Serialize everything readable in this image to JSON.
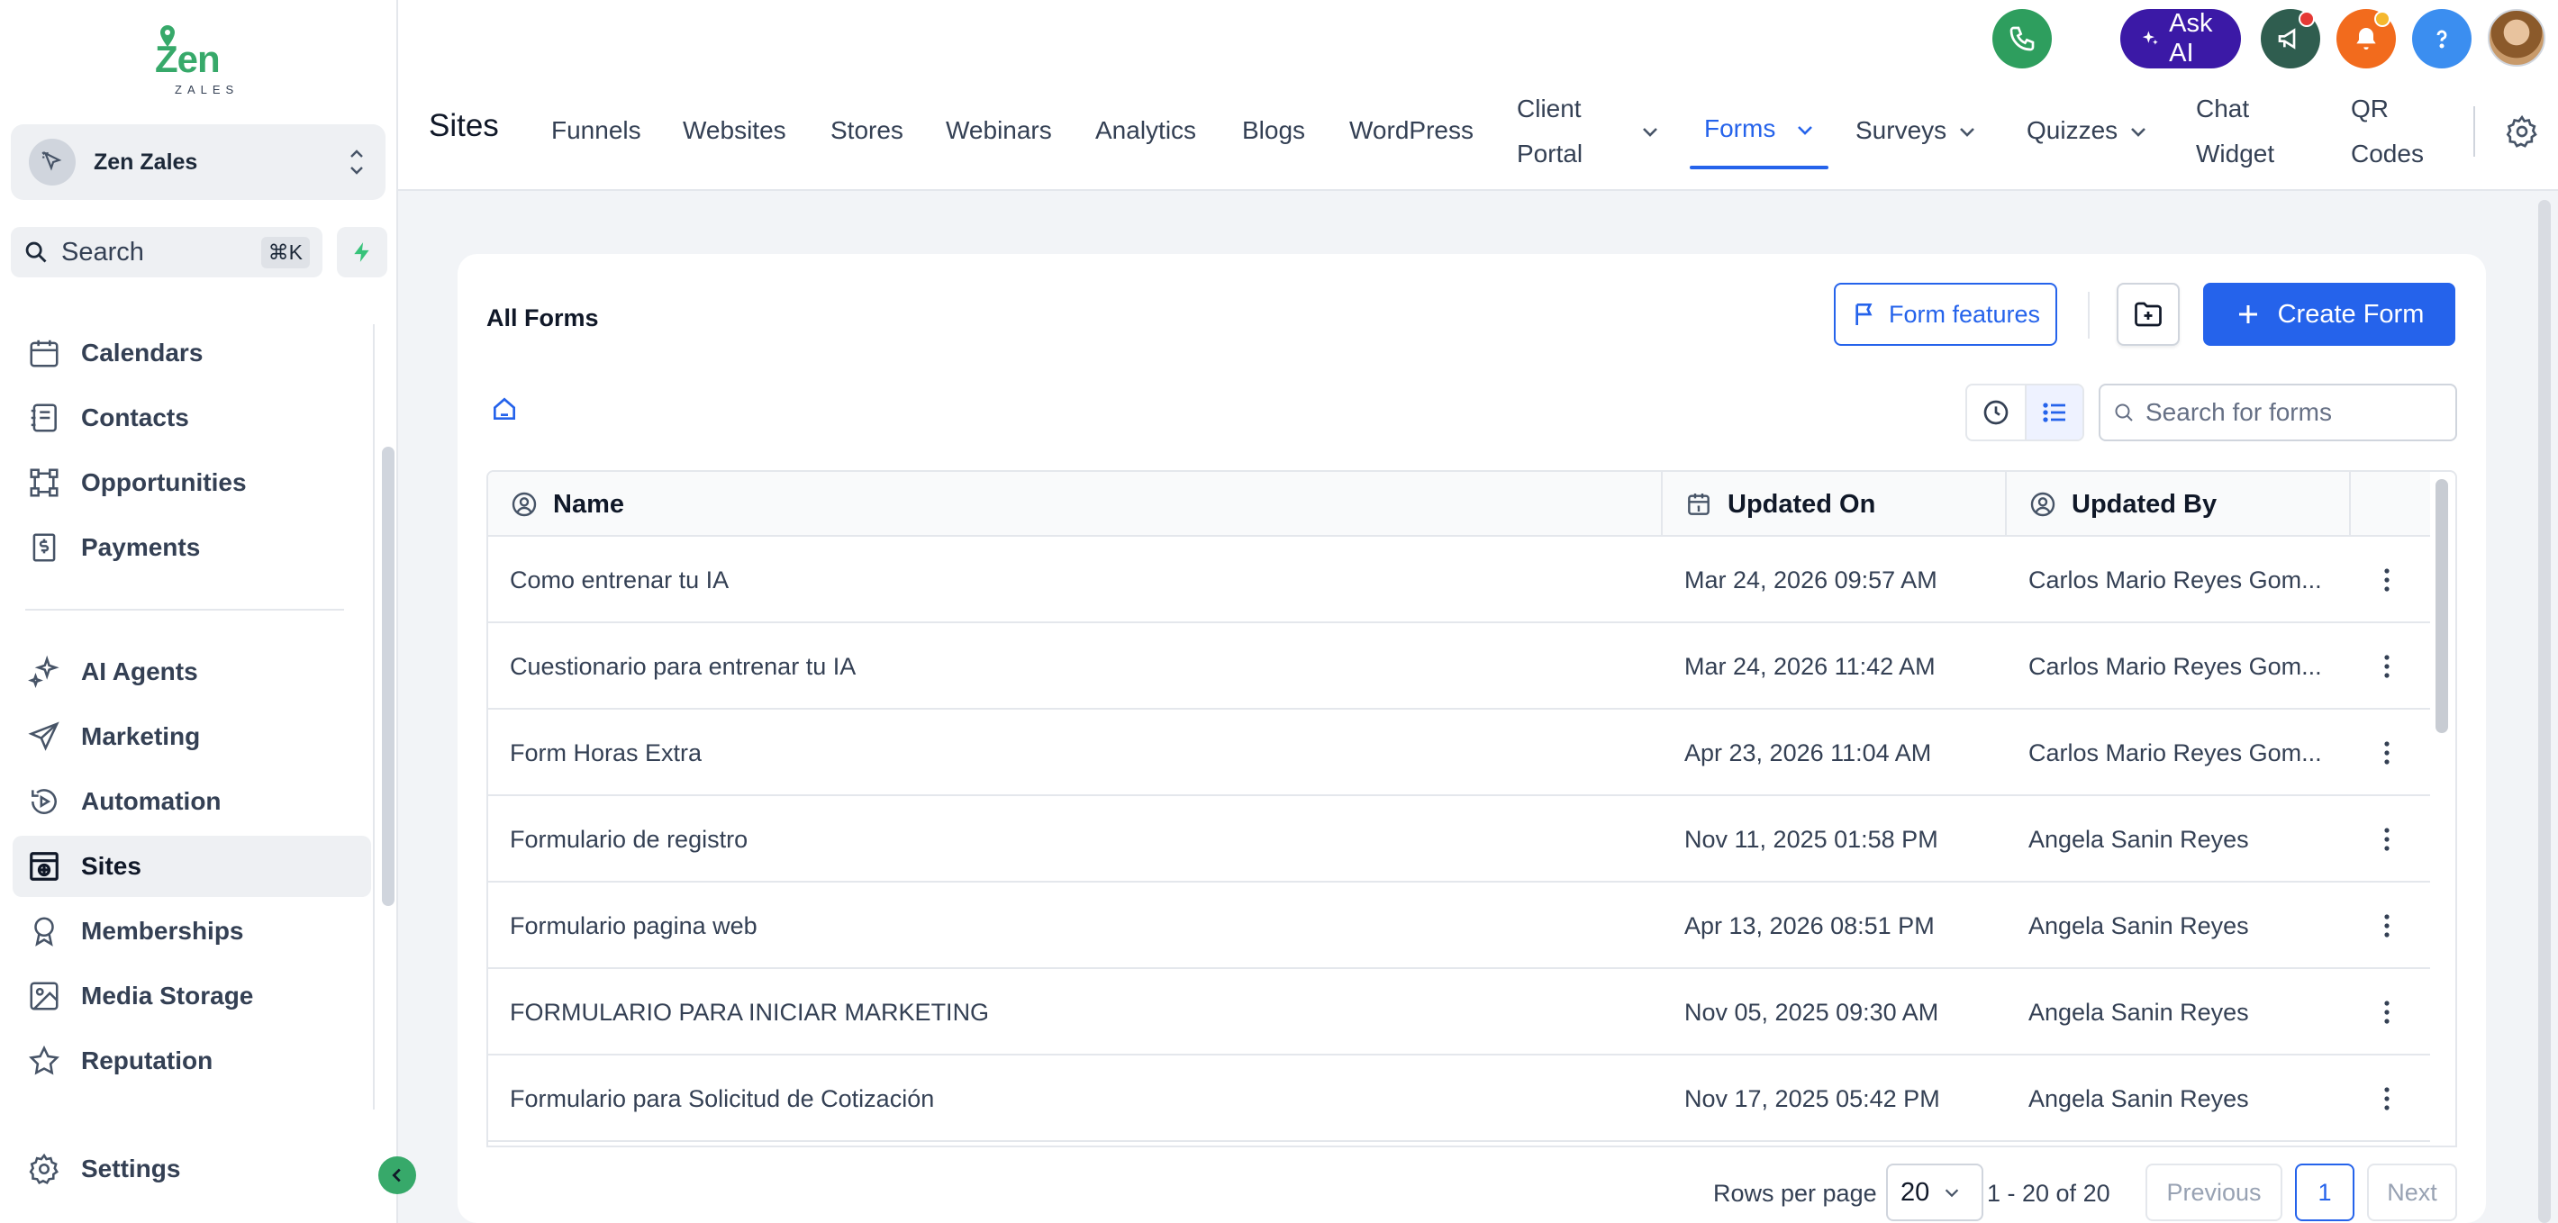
{
  "brand": {
    "logo_text": "Zen",
    "logo_sub": "ZALES",
    "accent": "#37a96a"
  },
  "account": {
    "name": "Zen Zales"
  },
  "search": {
    "label": "Search",
    "shortcut": "⌘K"
  },
  "sidebar": {
    "items": [
      {
        "label": "Calendars",
        "icon": "calendar-icon"
      },
      {
        "label": "Contacts",
        "icon": "contacts-icon"
      },
      {
        "label": "Opportunities",
        "icon": "opportunities-icon"
      },
      {
        "label": "Payments",
        "icon": "payments-icon"
      },
      {
        "label": "AI Agents",
        "icon": "sparkles-icon"
      },
      {
        "label": "Marketing",
        "icon": "send-icon"
      },
      {
        "label": "Automation",
        "icon": "automation-icon"
      },
      {
        "label": "Sites",
        "icon": "sites-icon",
        "active": true
      },
      {
        "label": "Memberships",
        "icon": "badge-icon"
      },
      {
        "label": "Media Storage",
        "icon": "image-icon"
      },
      {
        "label": "Reputation",
        "icon": "star-icon"
      }
    ],
    "settings_label": "Settings"
  },
  "header": {
    "title": "Sites",
    "ask_ai_label": "Ask AI",
    "tabs": [
      {
        "label": "Funnels"
      },
      {
        "label": "Websites"
      },
      {
        "label": "Stores"
      },
      {
        "label": "Webinars"
      },
      {
        "label": "Analytics"
      },
      {
        "label": "Blogs"
      },
      {
        "label": "WordPress"
      },
      {
        "label_line1": "Client",
        "label_line2": "Portal"
      },
      {
        "label": "Forms",
        "active": true
      },
      {
        "label": "Surveys"
      },
      {
        "label": "Quizzes"
      },
      {
        "label_line1": "Chat",
        "label_line2": "Widget"
      },
      {
        "label_line1": "QR",
        "label_line2": "Codes"
      }
    ]
  },
  "forms": {
    "title": "All Forms",
    "features_label": "Form features",
    "create_label": "Create Form",
    "search_placeholder": "Search for forms",
    "columns": {
      "name": "Name",
      "updated_on": "Updated On",
      "updated_by": "Updated By"
    },
    "rows": [
      {
        "name": "Como entrenar tu IA",
        "updated_on": "Mar 24, 2026 09:57 AM",
        "updated_by": "Carlos Mario Reyes Gom..."
      },
      {
        "name": "Cuestionario para entrenar tu IA",
        "updated_on": "Mar 24, 2026 11:42 AM",
        "updated_by": "Carlos Mario Reyes Gom..."
      },
      {
        "name": "Form Horas Extra",
        "updated_on": "Apr 23, 2026 11:04 AM",
        "updated_by": "Carlos Mario Reyes Gom..."
      },
      {
        "name": "Formulario de registro",
        "updated_on": "Nov 11, 2025 01:58 PM",
        "updated_by": "Angela Sanin Reyes"
      },
      {
        "name": "Formulario pagina web",
        "updated_on": "Apr 13, 2026 08:51 PM",
        "updated_by": "Angela Sanin Reyes"
      },
      {
        "name": "FORMULARIO PARA INICIAR MARKETING",
        "updated_on": "Nov 05, 2025 09:30 AM",
        "updated_by": "Angela Sanin Reyes"
      },
      {
        "name": "Formulario para Solicitud de Cotización",
        "updated_on": "Nov 17, 2025 05:42 PM",
        "updated_by": "Angela Sanin Reyes"
      }
    ]
  },
  "pagination": {
    "rows_per_page_label": "Rows per page",
    "rows_per_page": "20",
    "range": "1 - 20 of 20",
    "previous_label": "Previous",
    "current_page": "1",
    "next_label": "Next"
  }
}
